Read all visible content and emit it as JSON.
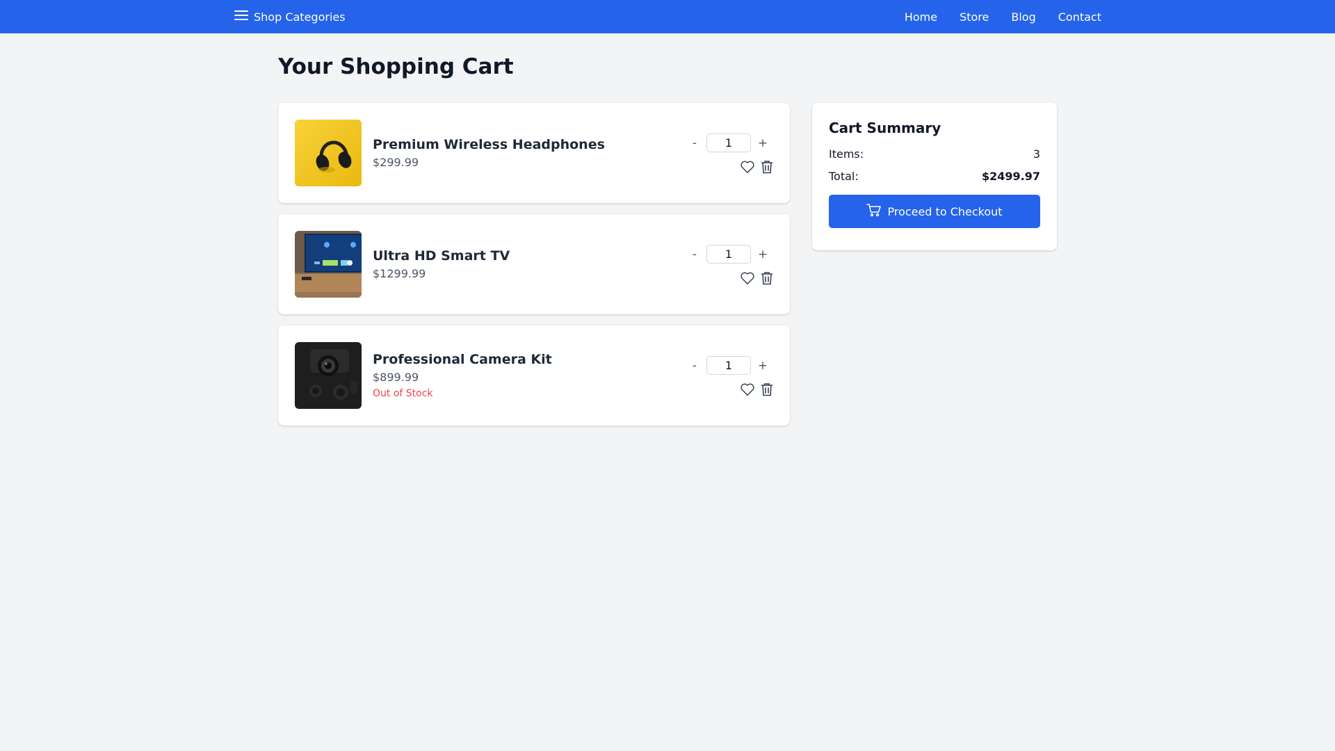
{
  "header": {
    "categories_label": "Shop Categories",
    "nav": [
      "Home",
      "Store",
      "Blog",
      "Contact"
    ]
  },
  "page": {
    "title": "Your Shopping Cart"
  },
  "cart": {
    "items": [
      {
        "name": "Premium Wireless Headphones",
        "price": "$299.99",
        "qty": "1",
        "status": "",
        "image_icon": "headphones-image"
      },
      {
        "name": "Ultra HD Smart TV",
        "price": "$1299.99",
        "qty": "1",
        "status": "",
        "image_icon": "smart-tv-image"
      },
      {
        "name": "Professional Camera Kit",
        "price": "$899.99",
        "qty": "1",
        "status": "Out of Stock",
        "image_icon": "camera-image"
      }
    ],
    "decrement_label": "-",
    "increment_label": "+"
  },
  "summary": {
    "title": "Cart Summary",
    "items_label": "Items:",
    "items_value": "3",
    "total_label": "Total:",
    "total_value": "$2499.97",
    "checkout_label": "Proceed to Checkout"
  },
  "colors": {
    "brand": "#2563eb",
    "background": "#f3f4f6",
    "danger": "#ef4444"
  }
}
